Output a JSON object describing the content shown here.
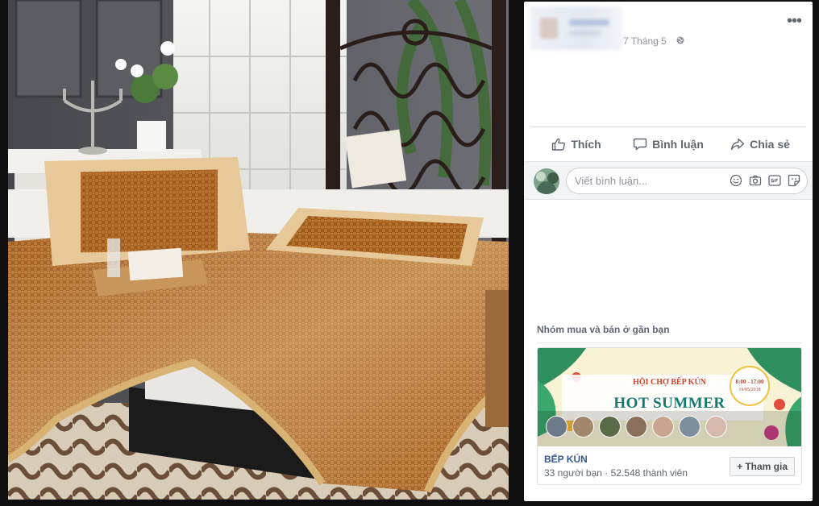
{
  "post": {
    "time": "7 Tháng 5",
    "more": "•••"
  },
  "actions": {
    "like": "Thích",
    "comment": "Bình luận",
    "share": "Chia sẻ"
  },
  "comment_box": {
    "placeholder": "Viết bình luận..."
  },
  "groups": {
    "heading": "Nhóm mua và bán ở gần bạn",
    "card": {
      "cover_subtitle": "HỘI CHỢ BẾP KÚN",
      "cover_title": "HOT SUMMER",
      "cover_time": "8:00 - 17:00",
      "cover_date": "19/05/2018",
      "name": "BẾP KÚN",
      "meta": "33 người bạn · 52.548 thành viên",
      "join_plus": "+",
      "join_label": "Tham gia"
    }
  }
}
